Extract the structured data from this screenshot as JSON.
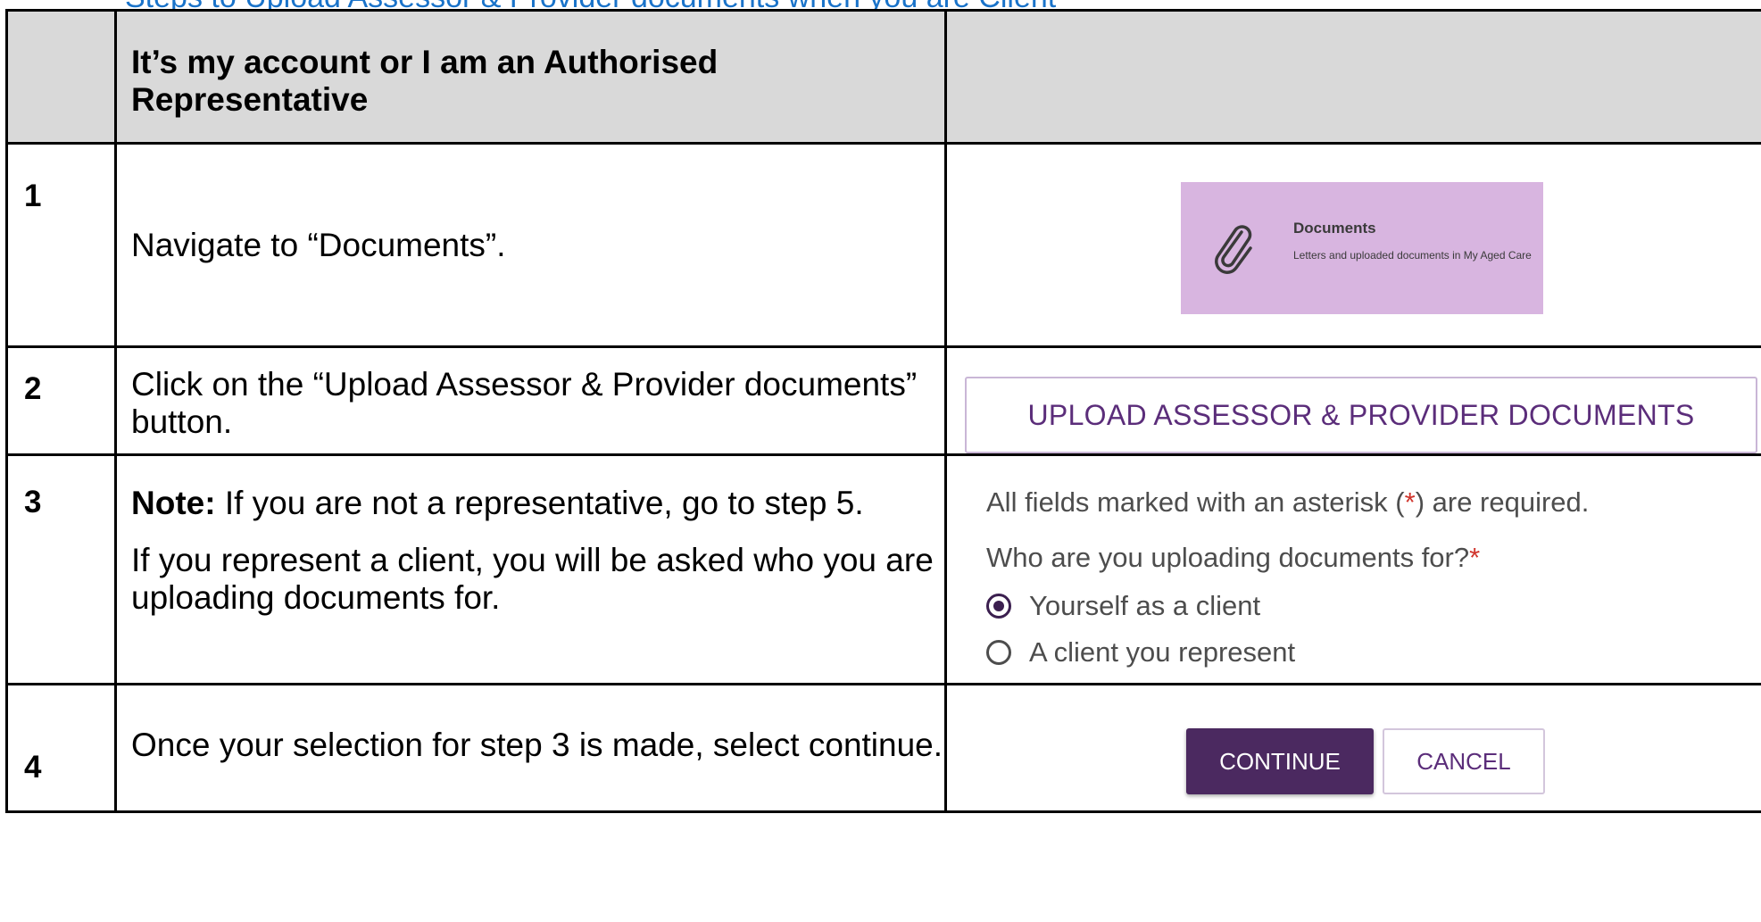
{
  "header": {
    "top_link": "Steps to Upload Assessor & Provider documents when you are Client",
    "col1": "",
    "col2": "It’s my account or I am an Authorised Representative",
    "col3": ""
  },
  "rows": [
    {
      "number": "1",
      "instruction": "Navigate to “Documents”.",
      "tile": {
        "title": "Documents",
        "subtitle": "Letters and uploaded documents in My Aged Care",
        "icon": "paperclip-icon",
        "bg_color": "#d8b5e0"
      }
    },
    {
      "number": "2",
      "instruction": "Click on the “Upload Assessor & Provider documents” button.",
      "button_label": "UPLOAD ASSESSOR & PROVIDER DOCUMENTS"
    },
    {
      "number": "3",
      "note_label": "Note:",
      "note_text": " If you are not a representative, go to step 5.",
      "instruction": "If you represent a client, you will be asked who you are uploading documents for.",
      "form": {
        "required_prefix": "All fields marked with an asterisk (",
        "asterisk": "*",
        "required_suffix": ") are required.",
        "question": "Who are you uploading documents for?",
        "question_asterisk": "*",
        "options": [
          {
            "label": "Yourself as a client",
            "selected": true
          },
          {
            "label": "A client you represent",
            "selected": false
          }
        ]
      }
    },
    {
      "number": "4",
      "instruction": "Once your selection for step 3 is made, select continue.",
      "continue_label": "CONTINUE",
      "cancel_label": "CANCEL",
      "accent_color": "#4b2960"
    }
  ]
}
